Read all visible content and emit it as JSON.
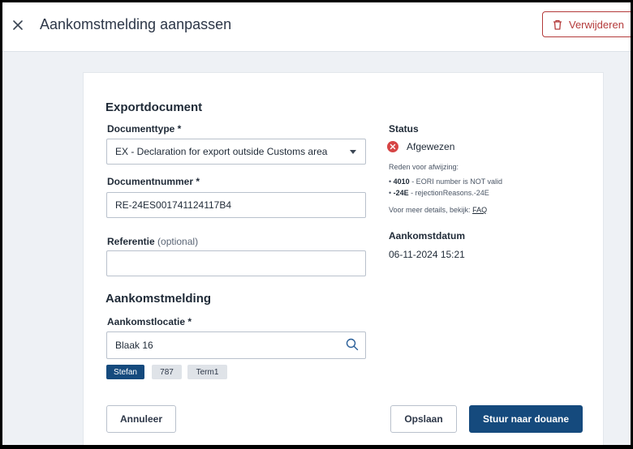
{
  "header": {
    "title": "Aankomstmelding aanpassen",
    "delete_label": "Verwijderen"
  },
  "export_document": {
    "section_title": "Exportdocument",
    "document_type": {
      "label": "Documenttype *",
      "value": "EX - Declaration for export outside Customs area"
    },
    "document_number": {
      "label": "Documentnummer *",
      "value": "RE-24ES001741124117B4"
    },
    "reference": {
      "label": "Referentie",
      "optional": "(optional)",
      "value": ""
    }
  },
  "arrival_notice": {
    "section_title": "Aankomstmelding",
    "location": {
      "label": "Aankomstlocatie *",
      "value": "Blaak 16"
    },
    "chips": [
      "Stefan",
      "787",
      "Term1"
    ]
  },
  "status": {
    "label": "Status",
    "value": "Afgewezen",
    "reason_title": "Reden voor afwijzing:",
    "reasons": [
      {
        "code": "4010",
        "text": " - EORI number is NOT valid"
      },
      {
        "code": "-24E",
        "text": " - rejectionReasons.-24E"
      }
    ],
    "more_details_prefix": "Voor meer details, bekijk: ",
    "faq_link": "FAQ",
    "arrival_date_label": "Aankomstdatum",
    "arrival_date_value": "06-11-2024 15:21"
  },
  "actions": {
    "cancel": "Annuleer",
    "save": "Opslaan",
    "send": "Stuur naar douane"
  },
  "colors": {
    "primary": "#154a7d",
    "danger": "#b43a3a",
    "error_icon": "#d64545"
  }
}
